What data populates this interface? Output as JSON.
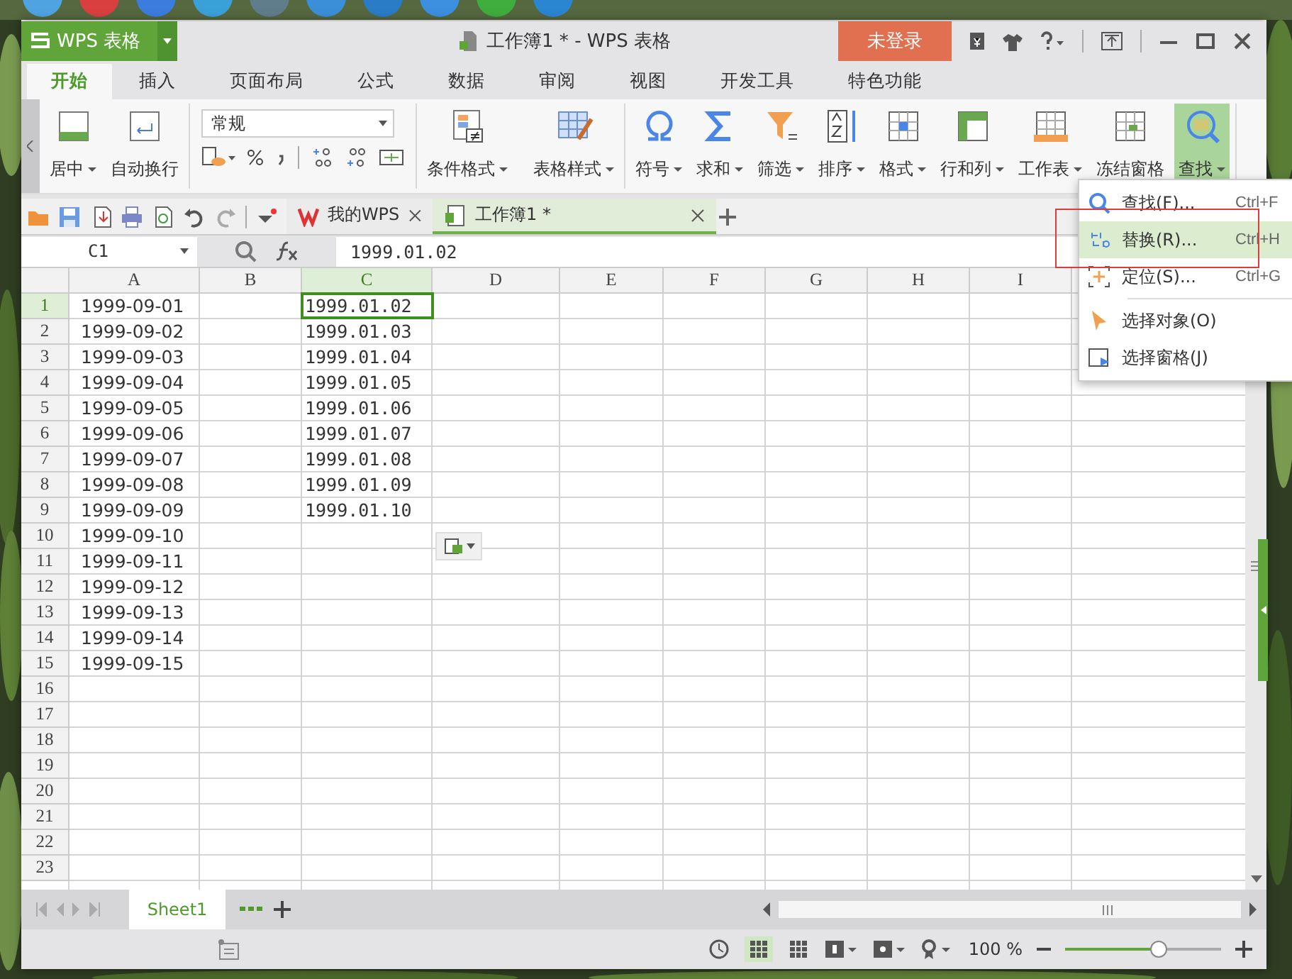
{
  "app_menu": {
    "label": "WPS 表格"
  },
  "window": {
    "title": "工作簿1 * - WPS 表格"
  },
  "login_button": {
    "label": "未登录"
  },
  "ribbon_tabs": [
    {
      "label": "开始",
      "selected": true
    },
    {
      "label": "插入",
      "selected": false
    },
    {
      "label": "页面布局",
      "selected": false
    },
    {
      "label": "公式",
      "selected": false
    },
    {
      "label": "数据",
      "selected": false
    },
    {
      "label": "审阅",
      "selected": false
    },
    {
      "label": "视图",
      "selected": false
    },
    {
      "label": "开发工具",
      "selected": false
    },
    {
      "label": "特色功能",
      "selected": false
    }
  ],
  "ribbon": {
    "number_format": {
      "value": "常规"
    },
    "groups": [
      {
        "buttons": [
          {
            "label": "居中",
            "dropdown": true,
            "selected": false
          },
          {
            "label": "自动换行",
            "dropdown": false,
            "selected": false
          }
        ]
      },
      {
        "buttons": [
          {
            "label": "条件格式",
            "dropdown": true,
            "selected": false
          },
          {
            "label": "表格样式",
            "dropdown": true,
            "selected": false
          }
        ]
      },
      {
        "buttons": [
          {
            "label": "符号",
            "dropdown": true,
            "selected": false
          },
          {
            "label": "求和",
            "dropdown": true,
            "selected": false
          },
          {
            "label": "筛选",
            "dropdown": true,
            "selected": false
          },
          {
            "label": "排序",
            "dropdown": true,
            "selected": false
          },
          {
            "label": "格式",
            "dropdown": true,
            "selected": false
          },
          {
            "label": "行和列",
            "dropdown": true,
            "selected": false
          },
          {
            "label": "工作表",
            "dropdown": true,
            "selected": false
          },
          {
            "label": "冻结窗格",
            "dropdown": false,
            "selected": false
          },
          {
            "label": "查找",
            "dropdown": true,
            "selected": true
          }
        ]
      }
    ]
  },
  "doc_tabs": [
    {
      "label": "我的WPS",
      "selected": false
    },
    {
      "label": "工作簿1 *",
      "selected": true
    }
  ],
  "formula_bar": {
    "cell_name": "C1",
    "formula": "1999.01.02"
  },
  "sheet": {
    "columns": [
      {
        "label": "A",
        "selected": false
      },
      {
        "label": "B",
        "selected": false
      },
      {
        "label": "C",
        "selected": true
      },
      {
        "label": "D",
        "selected": false
      },
      {
        "label": "E",
        "selected": false
      },
      {
        "label": "F",
        "selected": false
      },
      {
        "label": "G",
        "selected": false
      },
      {
        "label": "H",
        "selected": false
      },
      {
        "label": "I",
        "selected": false
      }
    ],
    "rows": [
      {
        "number": "1",
        "selected": true,
        "cells": [
          "1999-09-01",
          "",
          "1999.01.02"
        ]
      },
      {
        "number": "2",
        "selected": false,
        "cells": [
          "1999-09-02",
          "",
          "1999.01.03"
        ]
      },
      {
        "number": "3",
        "selected": false,
        "cells": [
          "1999-09-03",
          "",
          "1999.01.04"
        ]
      },
      {
        "number": "4",
        "selected": false,
        "cells": [
          "1999-09-04",
          "",
          "1999.01.05"
        ]
      },
      {
        "number": "5",
        "selected": false,
        "cells": [
          "1999-09-05",
          "",
          "1999.01.06"
        ]
      },
      {
        "number": "6",
        "selected": false,
        "cells": [
          "1999-09-06",
          "",
          "1999.01.07"
        ]
      },
      {
        "number": "7",
        "selected": false,
        "cells": [
          "1999-09-07",
          "",
          "1999.01.08"
        ]
      },
      {
        "number": "8",
        "selected": false,
        "cells": [
          "1999-09-08",
          "",
          "1999.01.09"
        ]
      },
      {
        "number": "9",
        "selected": false,
        "cells": [
          "1999-09-09",
          "",
          "1999.01.10"
        ]
      },
      {
        "number": "10",
        "selected": false,
        "cells": [
          "1999-09-10"
        ]
      },
      {
        "number": "11",
        "selected": false,
        "cells": [
          "1999-09-11"
        ]
      },
      {
        "number": "12",
        "selected": false,
        "cells": [
          "1999-09-12"
        ]
      },
      {
        "number": "13",
        "selected": false,
        "cells": [
          "1999-09-13"
        ]
      },
      {
        "number": "14",
        "selected": false,
        "cells": [
          "1999-09-14"
        ]
      },
      {
        "number": "15",
        "selected": false,
        "cells": [
          "1999-09-15"
        ]
      },
      {
        "number": "16",
        "selected": false,
        "cells": []
      },
      {
        "number": "17",
        "selected": false,
        "cells": []
      },
      {
        "number": "18",
        "selected": false,
        "cells": []
      },
      {
        "number": "19",
        "selected": false,
        "cells": []
      },
      {
        "number": "20",
        "selected": false,
        "cells": []
      },
      {
        "number": "21",
        "selected": false,
        "cells": []
      },
      {
        "number": "22",
        "selected": false,
        "cells": []
      },
      {
        "number": "23",
        "selected": false,
        "cells": []
      }
    ]
  },
  "find_menu": {
    "items": [
      {
        "label": "查找(F)...",
        "shortcut": "Ctrl+F",
        "selected": false
      },
      {
        "label": "替换(R)...",
        "shortcut": "Ctrl+H",
        "selected": true
      },
      {
        "label": "定位(S)...",
        "shortcut": "Ctrl+G",
        "selected": false
      },
      {
        "label": "选择对象(O)",
        "selected": false
      },
      {
        "label": "选择窗格(J)",
        "selected": false
      }
    ]
  },
  "sheet_tabs": [
    {
      "label": "Sheet1",
      "selected": true
    }
  ],
  "status_bar": {
    "zoom": "100 %",
    "zoom_level": {
      "level": 0.6
    }
  }
}
